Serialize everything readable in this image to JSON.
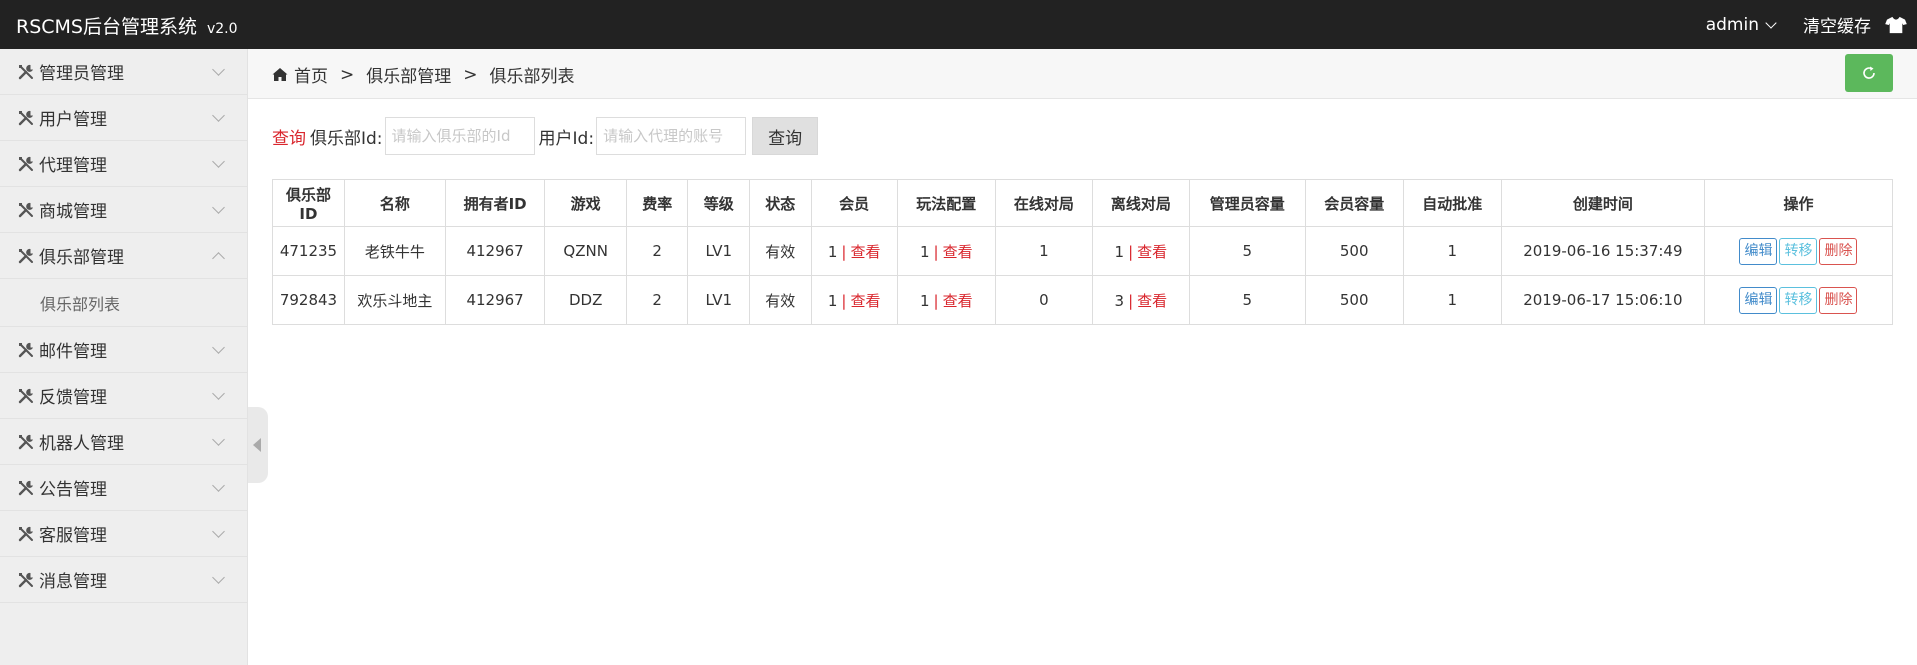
{
  "brand": {
    "name": "RSCMS后台管理系统",
    "version": "v2.0"
  },
  "topbar": {
    "user": "admin",
    "clear_cache": "清空缓存",
    "theme_icon": "shirt-icon"
  },
  "sidebar": {
    "items": [
      {
        "label": "管理员管理"
      },
      {
        "label": "用户管理"
      },
      {
        "label": "代理管理"
      },
      {
        "label": "商城管理"
      },
      {
        "label": "俱乐部管理",
        "expanded": true,
        "sub": "俱乐部列表"
      },
      {
        "label": "邮件管理"
      },
      {
        "label": "反馈管理"
      },
      {
        "label": "机器人管理"
      },
      {
        "label": "公告管理"
      },
      {
        "label": "客服管理"
      },
      {
        "label": "消息管理"
      }
    ]
  },
  "breadcrumb": {
    "home": "首页",
    "sep": ">",
    "level1": "俱乐部管理",
    "level2": "俱乐部列表"
  },
  "search": {
    "title": "查询",
    "club_label": "俱乐部Id:",
    "club_placeholder": "请输入俱乐部的Id",
    "user_label": "用户Id:",
    "user_placeholder": "请输入代理的账号",
    "button": "查询"
  },
  "table": {
    "headers": [
      "俱乐部ID",
      "名称",
      "拥有者ID",
      "游戏",
      "费率",
      "等级",
      "状态",
      "会员",
      "玩法配置",
      "在线对局",
      "离线对局",
      "管理员容量",
      "会员容量",
      "自动批准",
      "创建时间",
      "操作"
    ],
    "view_text": "查看",
    "pipe": "|",
    "actions": {
      "edit": "编辑",
      "move": "转移",
      "delete": "删除"
    },
    "rows": [
      {
        "id": "471235",
        "name": "老铁牛牛",
        "owner": "412967",
        "game": "QZNN",
        "rate": "2",
        "level": "LV1",
        "status": "有效",
        "members": "1",
        "config": "1",
        "online": "1",
        "offline": "1",
        "offline_view": true,
        "admin_cap": "5",
        "member_cap": "500",
        "auto": "1",
        "created": "2019-06-16 15:37:49"
      },
      {
        "id": "792843",
        "name": "欢乐斗地主",
        "owner": "412967",
        "game": "DDZ",
        "rate": "2",
        "level": "LV1",
        "status": "有效",
        "members": "1",
        "config": "1",
        "online": "0",
        "offline": "3",
        "offline_view": true,
        "admin_cap": "5",
        "member_cap": "500",
        "auto": "1",
        "created": "2019-06-17 15:06:10"
      }
    ]
  },
  "colors": {
    "topbar": "#222222",
    "accent_red": "#d9262d",
    "refresh_green": "#5cb85c",
    "sidebar_bg": "#eeeeee"
  }
}
